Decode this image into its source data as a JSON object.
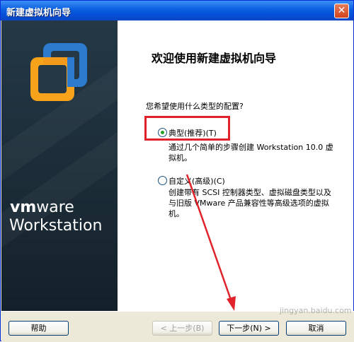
{
  "window": {
    "title": "新建虚拟机向导",
    "close_glyph": "✕"
  },
  "banner": {
    "brand_vm": "vm",
    "brand_ware": "ware",
    "product": "Workstation"
  },
  "content": {
    "heading": "欢迎使用新建虚拟机向导",
    "question": "您希望使用什么类型的配置?",
    "options": [
      {
        "label": "典型(推荐)(T)",
        "description": "通过几个简单的步骤创建 Workstation 10.0 虚拟机。",
        "selected": true
      },
      {
        "label": "自定义(高级)(C)",
        "description": "创建带有 SCSI 控制器类型、虚拟磁盘类型以及与旧版 VMware 产品兼容性等高级选项的虚拟机。",
        "selected": false
      }
    ]
  },
  "buttons": {
    "help": "帮助",
    "back": "< 上一步(B)",
    "next": "下一步(N) >",
    "cancel": "取消"
  },
  "watermark": "jingyan.baidu.com",
  "colors": {
    "titlebar": "#0a5fe0",
    "highlight": "#e0232b",
    "arrow": "#e0232b"
  }
}
